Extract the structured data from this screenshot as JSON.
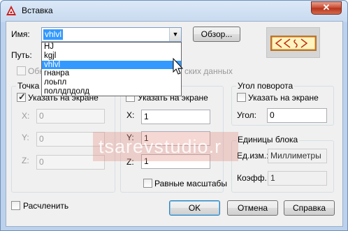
{
  "window": {
    "title": "Вставка",
    "close_label": "✕",
    "accent_color": "#c8472c"
  },
  "name": {
    "label": "Имя:",
    "value": "vhlvl",
    "browse_label": "Обзор...",
    "options": [
      "HJ",
      "kgjl",
      "vhlvl",
      "гнанра",
      "лоьпл",
      "поллдпдолд"
    ],
    "selected_index": 2
  },
  "path": {
    "label": "Путь:",
    "georef_label_visible_left": "Обн",
    "georef_label_visible_right": "ских данных"
  },
  "insertion": {
    "group_title": "Точка в",
    "specify_label": "Указать на экране",
    "specify_checked": true,
    "x_label": "X:",
    "y_label": "Y:",
    "z_label": "Z:",
    "x_value": "0",
    "y_value": "0",
    "z_value": "0"
  },
  "scale": {
    "specify_label": "Указать на экране",
    "specify_checked": false,
    "x_label": "X:",
    "y_label": "Y:",
    "z_label": "Z:",
    "x_value": "1",
    "y_value": "1",
    "z_value": "1",
    "uniform_label": "Равные масштабы",
    "uniform_checked": false
  },
  "rotation": {
    "group_title": "Угол поворота",
    "specify_label": "Указать на экране",
    "specify_checked": false,
    "angle_label": "Угол:",
    "angle_value": "0"
  },
  "units": {
    "group_title": "Единицы блока",
    "unit_label": "Ед.изм.:",
    "unit_value": "Миллиметры",
    "factor_label": "Коэфф.:",
    "factor_value": "1"
  },
  "explode": {
    "label": "Расчленить",
    "checked": false
  },
  "buttons": {
    "ok": "OK",
    "cancel": "Отмена",
    "help": "Справка"
  },
  "watermark": "tsarevstudio.r",
  "icons": {
    "app": "autocad-icon",
    "arrow": "chevron-down-icon",
    "cursor": "mouse-pointer-icon"
  }
}
